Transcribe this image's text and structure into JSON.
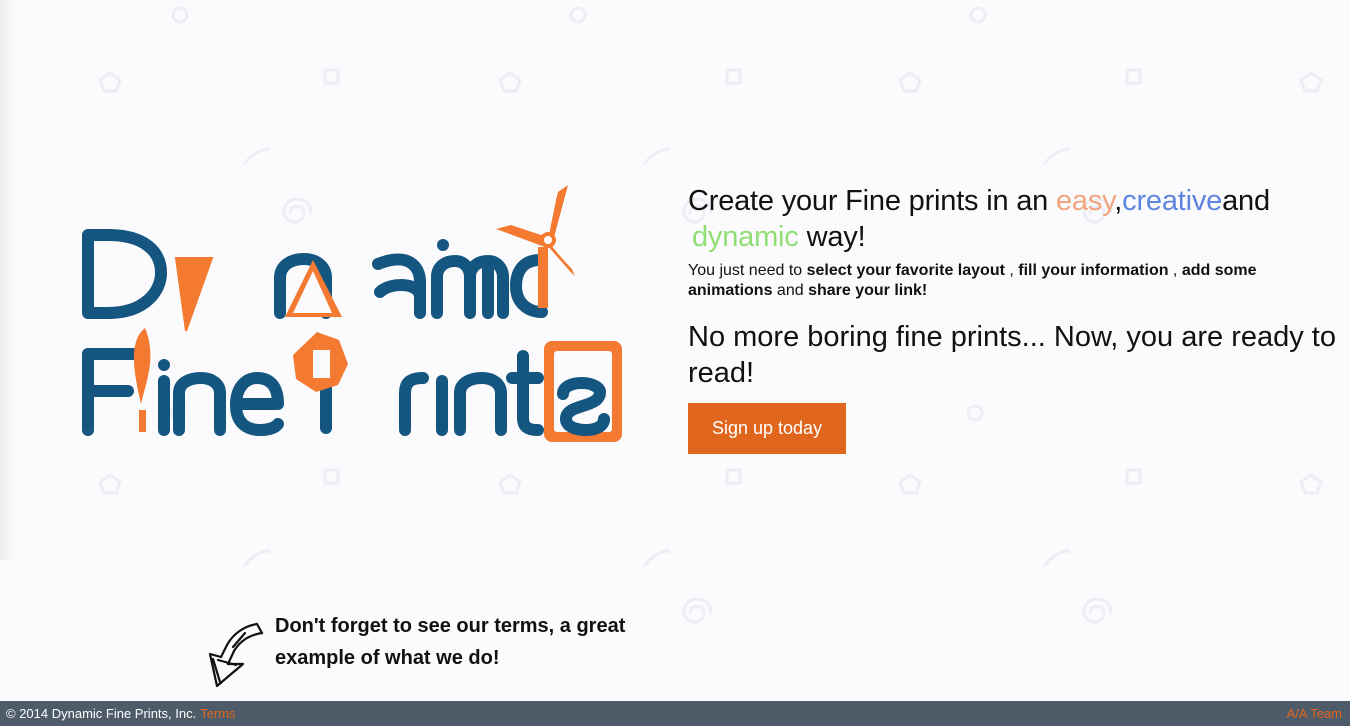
{
  "page": {
    "background": "#fbfbfd"
  },
  "logo": {
    "line1": "Dynamic",
    "line2": "Fine Prints",
    "colors": {
      "blue": "#145680",
      "orange": "#f47a32"
    }
  },
  "hero": {
    "headline": {
      "before": "Create your Fine prints in an ",
      "easy": "easy",
      "comma": ",",
      "creative": "creative",
      "and": "and",
      "dynamic": "dynamic",
      "after": "way!"
    },
    "subcopy": {
      "lead": "You just need to ",
      "step1": "select your favorite layout",
      "sep1": " , ",
      "step2": "fill your information",
      "sep2": " , ",
      "step3": "add some animations",
      "sep3": " and ",
      "step4": "share your link!"
    },
    "tagline": "No more boring fine prints... Now, you are ready to read!",
    "cta_label": "Sign up today",
    "cta_color": "#e0661e"
  },
  "terms_note": {
    "text": "Don't forget to see our terms, a great example of what we do!",
    "icon": "arrow-icon"
  },
  "footer": {
    "copyright": "© 2014 Dynamic Fine Prints, Inc.",
    "terms_link": "Terms",
    "credit": "A/A Team",
    "background": "#4e5b69",
    "accent": "#e0661e"
  }
}
